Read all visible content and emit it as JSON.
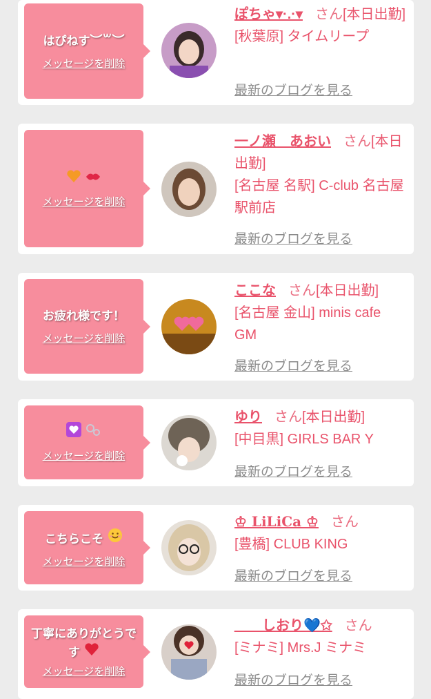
{
  "colors": {
    "accent": "#e9536b",
    "bubble": "#f78d9d",
    "link": "#8c8c8c"
  },
  "common": {
    "delete_label": "メッセージを削除",
    "blog_label": "最新のブログを見る",
    "san": "さん"
  },
  "rows": [
    {
      "message": "はぴねす",
      "message_icons": [
        "face-icon"
      ],
      "name": "ぽちゃ▾·.·▾",
      "status": "[本日出勤]",
      "shop": "[秋葉原] タイムリープ",
      "avatar_icon": "girl-avatar-icon"
    },
    {
      "message": "",
      "message_icons": [
        "orange-heart-icon",
        "kiss-mark-icon"
      ],
      "name": "一ノ瀬　あおい",
      "status": "[本日出勤]",
      "shop": "[名古屋 名駅] C-club 名古屋駅前店",
      "avatar_icon": "girl-avatar-icon"
    },
    {
      "message": "お疲れ様です！",
      "message_icons": [],
      "name": "ここな",
      "status": "[本日出勤]",
      "shop": "[名古屋 金山] minis cafe GM",
      "avatar_icon": "hearts-avatar-icon"
    },
    {
      "message": "",
      "message_icons": [
        "heart-box-icon",
        "bubbles-icon"
      ],
      "name": "ゆり",
      "status": "[本日出勤]",
      "shop": "[中目黒] GIRLS BAR Y",
      "avatar_icon": "girl-avatar-icon"
    },
    {
      "message": "こちらこそ",
      "message_icons": [
        "smile-icon"
      ],
      "name": "♔ LiLiCa ♔",
      "status": "",
      "shop": "[豊橋] CLUB KING",
      "avatar_icon": "girl-avatar-icon"
    },
    {
      "message": "丁寧にありがとうです",
      "message_icons": [
        "red-heart-icon"
      ],
      "name": "＿＿しおり💙✩",
      "status": "",
      "shop": "[ミナミ] Mrs.J ミナミ",
      "avatar_icon": "girl-avatar-icon"
    }
  ]
}
